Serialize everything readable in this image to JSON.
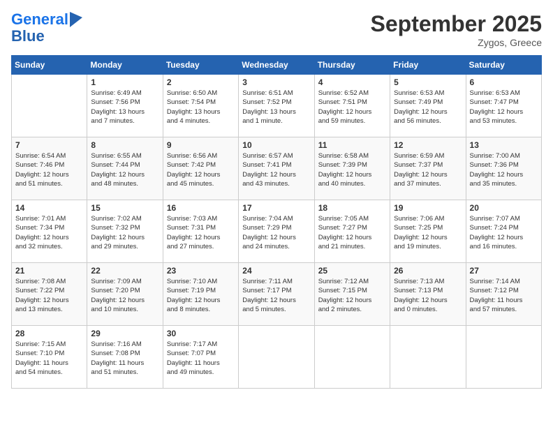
{
  "logo": {
    "line1": "General",
    "line2": "Blue"
  },
  "title": "September 2025",
  "location": "Zygos, Greece",
  "days_header": [
    "Sunday",
    "Monday",
    "Tuesday",
    "Wednesday",
    "Thursday",
    "Friday",
    "Saturday"
  ],
  "weeks": [
    [
      {
        "day": "",
        "lines": []
      },
      {
        "day": "1",
        "lines": [
          "Sunrise: 6:49 AM",
          "Sunset: 7:56 PM",
          "Daylight: 13 hours",
          "and 7 minutes."
        ]
      },
      {
        "day": "2",
        "lines": [
          "Sunrise: 6:50 AM",
          "Sunset: 7:54 PM",
          "Daylight: 13 hours",
          "and 4 minutes."
        ]
      },
      {
        "day": "3",
        "lines": [
          "Sunrise: 6:51 AM",
          "Sunset: 7:52 PM",
          "Daylight: 13 hours",
          "and 1 minute."
        ]
      },
      {
        "day": "4",
        "lines": [
          "Sunrise: 6:52 AM",
          "Sunset: 7:51 PM",
          "Daylight: 12 hours",
          "and 59 minutes."
        ]
      },
      {
        "day": "5",
        "lines": [
          "Sunrise: 6:53 AM",
          "Sunset: 7:49 PM",
          "Daylight: 12 hours",
          "and 56 minutes."
        ]
      },
      {
        "day": "6",
        "lines": [
          "Sunrise: 6:53 AM",
          "Sunset: 7:47 PM",
          "Daylight: 12 hours",
          "and 53 minutes."
        ]
      }
    ],
    [
      {
        "day": "7",
        "lines": [
          "Sunrise: 6:54 AM",
          "Sunset: 7:46 PM",
          "Daylight: 12 hours",
          "and 51 minutes."
        ]
      },
      {
        "day": "8",
        "lines": [
          "Sunrise: 6:55 AM",
          "Sunset: 7:44 PM",
          "Daylight: 12 hours",
          "and 48 minutes."
        ]
      },
      {
        "day": "9",
        "lines": [
          "Sunrise: 6:56 AM",
          "Sunset: 7:42 PM",
          "Daylight: 12 hours",
          "and 45 minutes."
        ]
      },
      {
        "day": "10",
        "lines": [
          "Sunrise: 6:57 AM",
          "Sunset: 7:41 PM",
          "Daylight: 12 hours",
          "and 43 minutes."
        ]
      },
      {
        "day": "11",
        "lines": [
          "Sunrise: 6:58 AM",
          "Sunset: 7:39 PM",
          "Daylight: 12 hours",
          "and 40 minutes."
        ]
      },
      {
        "day": "12",
        "lines": [
          "Sunrise: 6:59 AM",
          "Sunset: 7:37 PM",
          "Daylight: 12 hours",
          "and 37 minutes."
        ]
      },
      {
        "day": "13",
        "lines": [
          "Sunrise: 7:00 AM",
          "Sunset: 7:36 PM",
          "Daylight: 12 hours",
          "and 35 minutes."
        ]
      }
    ],
    [
      {
        "day": "14",
        "lines": [
          "Sunrise: 7:01 AM",
          "Sunset: 7:34 PM",
          "Daylight: 12 hours",
          "and 32 minutes."
        ]
      },
      {
        "day": "15",
        "lines": [
          "Sunrise: 7:02 AM",
          "Sunset: 7:32 PM",
          "Daylight: 12 hours",
          "and 29 minutes."
        ]
      },
      {
        "day": "16",
        "lines": [
          "Sunrise: 7:03 AM",
          "Sunset: 7:31 PM",
          "Daylight: 12 hours",
          "and 27 minutes."
        ]
      },
      {
        "day": "17",
        "lines": [
          "Sunrise: 7:04 AM",
          "Sunset: 7:29 PM",
          "Daylight: 12 hours",
          "and 24 minutes."
        ]
      },
      {
        "day": "18",
        "lines": [
          "Sunrise: 7:05 AM",
          "Sunset: 7:27 PM",
          "Daylight: 12 hours",
          "and 21 minutes."
        ]
      },
      {
        "day": "19",
        "lines": [
          "Sunrise: 7:06 AM",
          "Sunset: 7:25 PM",
          "Daylight: 12 hours",
          "and 19 minutes."
        ]
      },
      {
        "day": "20",
        "lines": [
          "Sunrise: 7:07 AM",
          "Sunset: 7:24 PM",
          "Daylight: 12 hours",
          "and 16 minutes."
        ]
      }
    ],
    [
      {
        "day": "21",
        "lines": [
          "Sunrise: 7:08 AM",
          "Sunset: 7:22 PM",
          "Daylight: 12 hours",
          "and 13 minutes."
        ]
      },
      {
        "day": "22",
        "lines": [
          "Sunrise: 7:09 AM",
          "Sunset: 7:20 PM",
          "Daylight: 12 hours",
          "and 10 minutes."
        ]
      },
      {
        "day": "23",
        "lines": [
          "Sunrise: 7:10 AM",
          "Sunset: 7:19 PM",
          "Daylight: 12 hours",
          "and 8 minutes."
        ]
      },
      {
        "day": "24",
        "lines": [
          "Sunrise: 7:11 AM",
          "Sunset: 7:17 PM",
          "Daylight: 12 hours",
          "and 5 minutes."
        ]
      },
      {
        "day": "25",
        "lines": [
          "Sunrise: 7:12 AM",
          "Sunset: 7:15 PM",
          "Daylight: 12 hours",
          "and 2 minutes."
        ]
      },
      {
        "day": "26",
        "lines": [
          "Sunrise: 7:13 AM",
          "Sunset: 7:13 PM",
          "Daylight: 12 hours",
          "and 0 minutes."
        ]
      },
      {
        "day": "27",
        "lines": [
          "Sunrise: 7:14 AM",
          "Sunset: 7:12 PM",
          "Daylight: 11 hours",
          "and 57 minutes."
        ]
      }
    ],
    [
      {
        "day": "28",
        "lines": [
          "Sunrise: 7:15 AM",
          "Sunset: 7:10 PM",
          "Daylight: 11 hours",
          "and 54 minutes."
        ]
      },
      {
        "day": "29",
        "lines": [
          "Sunrise: 7:16 AM",
          "Sunset: 7:08 PM",
          "Daylight: 11 hours",
          "and 51 minutes."
        ]
      },
      {
        "day": "30",
        "lines": [
          "Sunrise: 7:17 AM",
          "Sunset: 7:07 PM",
          "Daylight: 11 hours",
          "and 49 minutes."
        ]
      },
      {
        "day": "",
        "lines": []
      },
      {
        "day": "",
        "lines": []
      },
      {
        "day": "",
        "lines": []
      },
      {
        "day": "",
        "lines": []
      }
    ]
  ]
}
